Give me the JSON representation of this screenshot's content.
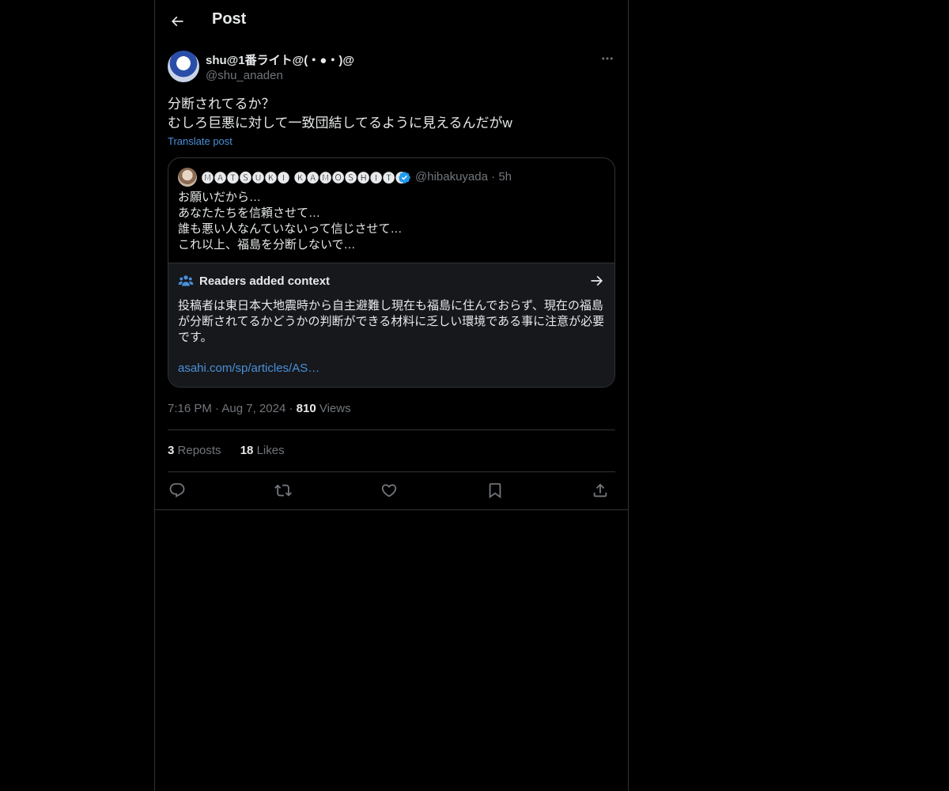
{
  "header": {
    "title": "Post",
    "back_icon": "arrow-left-icon"
  },
  "post": {
    "author_name": "shu@1番ライト@(・●・)@",
    "author_handle": "@shu_anaden",
    "text_lines": [
      "分断されてるか？",
      "むしろ巨悪に対して一致団結してるように見えるんだがw"
    ],
    "translate_label": "Translate post",
    "time": "7:16 PM",
    "date": "Aug 7, 2024",
    "views_count": "810",
    "views_label": "Views"
  },
  "quote": {
    "author_name": "🅜🅐🅣🅢🅤🅚🅘 🅚🅐🅜🅞🅢🅗🅘🅣🅐",
    "handle": "@hibakuyada",
    "age": "5h",
    "text_lines": [
      "お願いだから…",
      "あなたたちを信頼させて…",
      "誰も悪い人なんていないって信じさせて…",
      "これ以上、福島を分断しないで…"
    ]
  },
  "context": {
    "title": "Readers added context",
    "body": "投稿者は東日本大地震時から自主避難し現在も福島に住んでおらず、現在の福島が分断されてるかどうかの判断ができる材料に乏しい環境である事に注意が必要です。",
    "link": "asahi.com/sp/articles/AS…"
  },
  "stats": {
    "reposts_count": "3",
    "reposts_label": "Reposts",
    "likes_count": "18",
    "likes_label": "Likes"
  },
  "colors": {
    "background": "#000000",
    "border": "#2f3336",
    "text": "#e7e9ea",
    "muted": "#71767b",
    "link": "#4a90d9",
    "verified": "#1d9bf0",
    "context_bg": "#16181c"
  }
}
